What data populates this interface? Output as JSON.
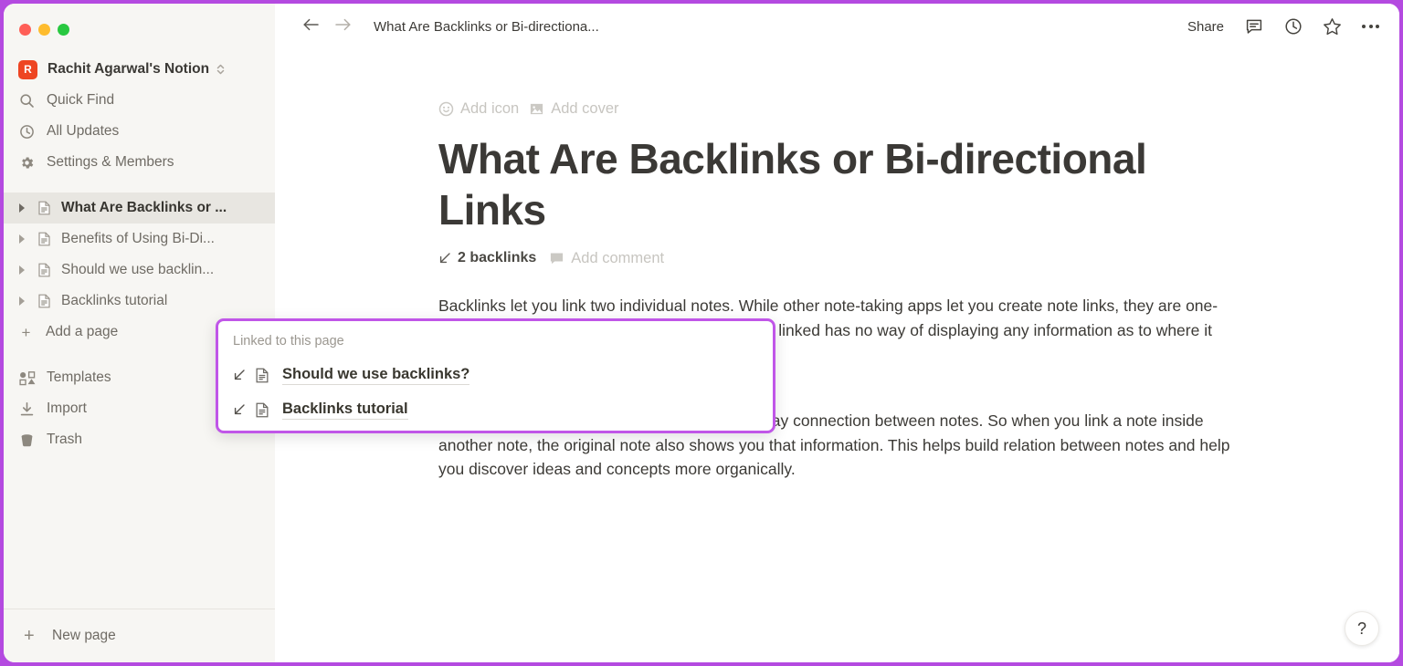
{
  "window": {
    "traffic_lights": [
      "close",
      "minimize",
      "maximize"
    ],
    "accent_border_color": "#b44ae0"
  },
  "sidebar": {
    "workspace": {
      "avatar_letter": "R",
      "avatar_color": "#ee4522",
      "name": "Rachit Agarwal's Notion",
      "chevron_icon": "chevron-updown-icon"
    },
    "nav": [
      {
        "icon": "search-icon",
        "label": "Quick Find"
      },
      {
        "icon": "clock-icon",
        "label": "All Updates"
      },
      {
        "icon": "gear-icon",
        "label": "Settings & Members"
      }
    ],
    "pages": [
      {
        "label": "What Are Backlinks or ...",
        "selected": true
      },
      {
        "label": "Benefits of Using Bi-Di...",
        "selected": false
      },
      {
        "label": "Should we use backlin...",
        "selected": false
      },
      {
        "label": "Backlinks tutorial",
        "selected": false
      }
    ],
    "add_page_label": "Add a page",
    "utilities": [
      {
        "icon": "templates-icon",
        "label": "Templates"
      },
      {
        "icon": "import-icon",
        "label": "Import"
      },
      {
        "icon": "trash-icon",
        "label": "Trash"
      }
    ],
    "new_page_label": "New page"
  },
  "topbar": {
    "back_icon": "arrow-left-icon",
    "forward_icon": "arrow-right-icon",
    "breadcrumb": "What Are Backlinks or Bi-directiona...",
    "share_label": "Share",
    "comment_icon": "comment-icon",
    "history_icon": "clock-icon",
    "favorite_icon": "star-icon",
    "more_icon": "more-horizontal-icon"
  },
  "page": {
    "add_icon_label": "Add icon",
    "add_icon_glyph": "smiley-icon",
    "add_cover_label": "Add cover",
    "add_cover_glyph": "image-icon",
    "title": "What Are Backlinks or Bi-directional Links",
    "backlinks_label": "2 backlinks",
    "backlinks_icon": "arrow-down-left-icon",
    "add_comment_label": "Add comment",
    "add_comment_icon": "comment-icon",
    "paragraph_1": "Backlinks let you link two individual notes. While other note-taking apps let you create note links, they are one-way pointers. That means the note that is being linked has no way of displaying any information as to where it has been linked.",
    "paragraph_2": "Backlinks, on the other hand, establish a two-way connection between notes. So when you link a note inside another note, the original note also shows you that information. This helps build relation between notes and help you discover ideas and concepts more organically."
  },
  "popover": {
    "border_color": "#c056e8",
    "header": "Linked to this page",
    "items": [
      {
        "label": "Should we use backlinks?",
        "arrow_icon": "arrow-down-left-icon",
        "doc_icon": "document-icon"
      },
      {
        "label": "Backlinks tutorial",
        "arrow_icon": "arrow-down-left-icon",
        "doc_icon": "document-icon"
      }
    ]
  },
  "help": {
    "label": "?",
    "icon": "question-mark-icon"
  }
}
